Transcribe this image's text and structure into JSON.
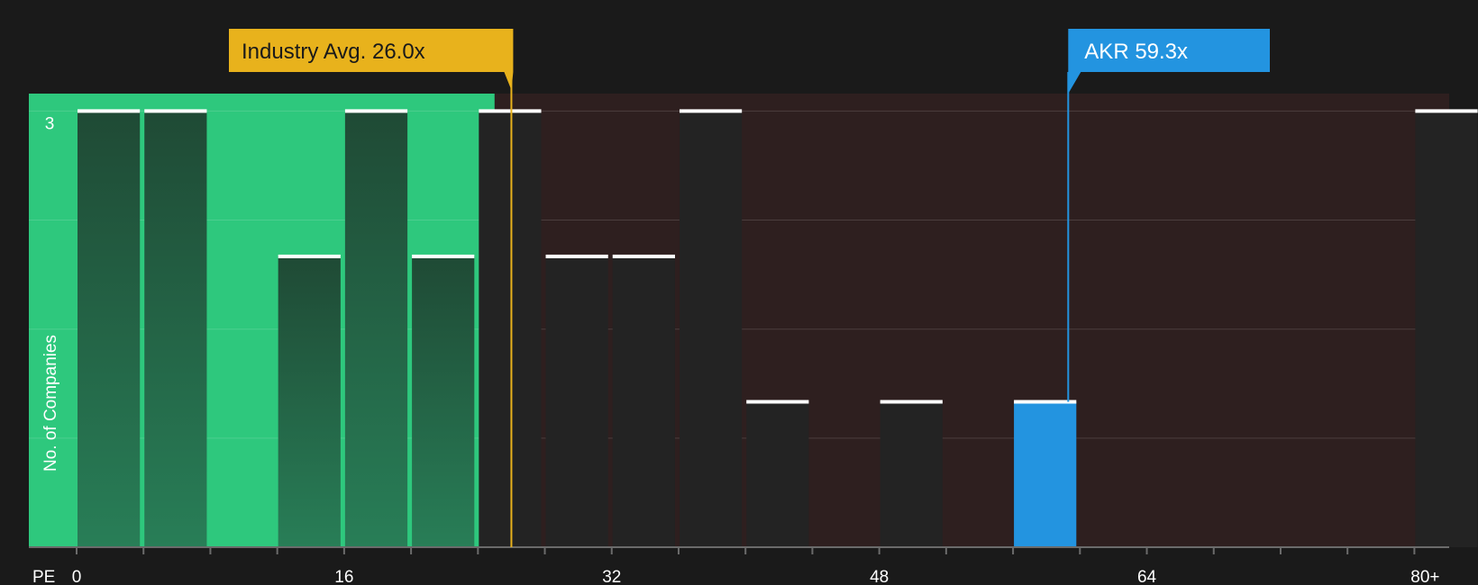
{
  "chart_data": {
    "type": "bar",
    "xlabel": "PE",
    "ylabel": "No. of Companies",
    "x_ticks": [
      "0",
      "16",
      "32",
      "48",
      "64",
      "80+"
    ],
    "y_ticks": [
      "3"
    ],
    "xlim": [
      0,
      81.6
    ],
    "ylim": [
      0,
      3.12
    ],
    "bin_width": 4,
    "bins": [
      {
        "start": 0,
        "value": 3
      },
      {
        "start": 4,
        "value": 3
      },
      {
        "start": 12,
        "value": 2
      },
      {
        "start": 16,
        "value": 3
      },
      {
        "start": 20,
        "value": 2
      },
      {
        "start": 24,
        "value": 3
      },
      {
        "start": 28,
        "value": 2
      },
      {
        "start": 32,
        "value": 2
      },
      {
        "start": 36,
        "value": 3
      },
      {
        "start": 40,
        "value": 1
      },
      {
        "start": 48,
        "value": 1
      },
      {
        "start": 56,
        "value": 1,
        "highlight": true
      },
      {
        "start": 80,
        "value": 3
      }
    ],
    "industry_avg": {
      "label": "Industry Avg. 26.0x",
      "value": 26.0
    },
    "company": {
      "label": "AKR 59.3x",
      "value": 59.3
    },
    "undervalued_region_max": 25.0,
    "grid": true,
    "colors": {
      "background": "#1a1a1a",
      "green_region": "#2ec87d",
      "red_region": "#2e1f1f",
      "bar_dark": "#232323",
      "bar_highlight": "#2394e0",
      "industry_line": "#e8b21c",
      "company_line": "#2394e0"
    }
  }
}
